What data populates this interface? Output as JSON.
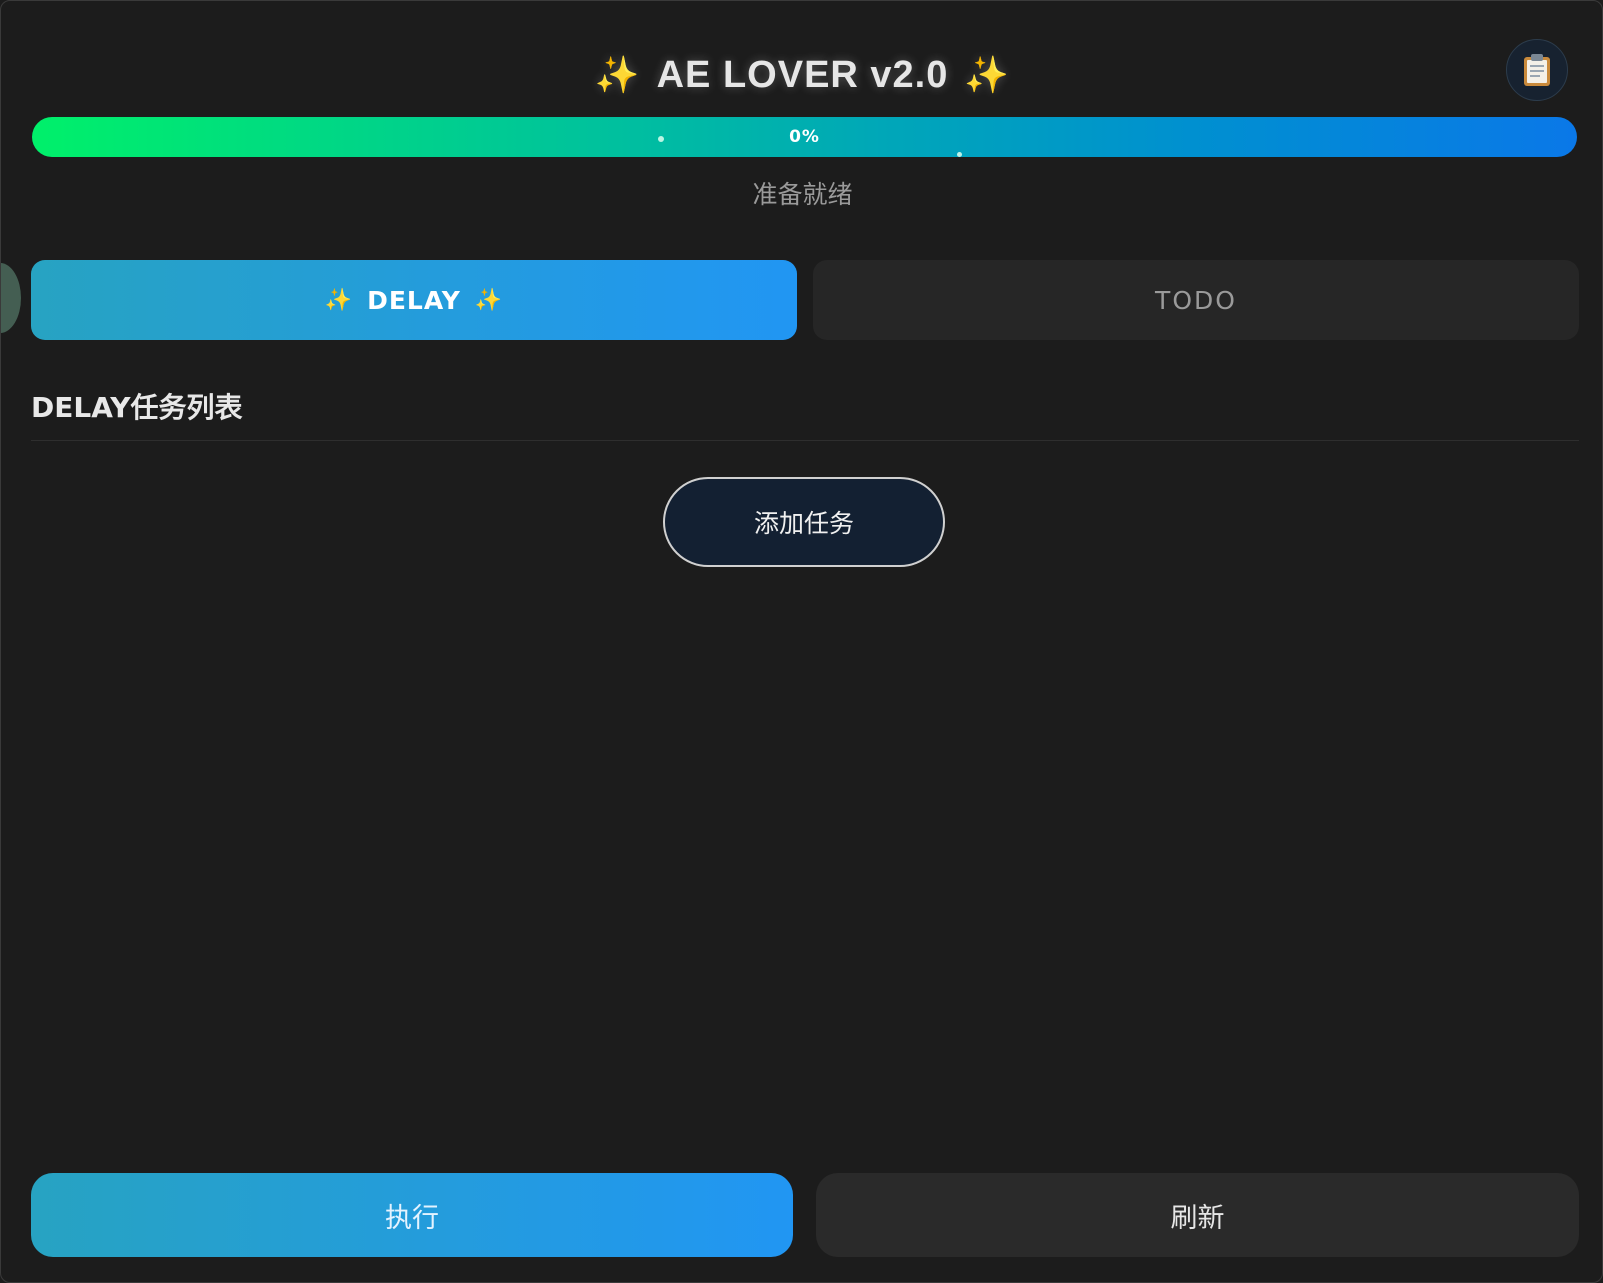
{
  "header": {
    "title_text": "AE LOVER v2.0",
    "sparkle_glyph": "✨",
    "clipboard_icon": "clipboard-icon"
  },
  "progress": {
    "value_percent": 0,
    "label": "0%"
  },
  "status": {
    "text": "准备就绪"
  },
  "tabs": [
    {
      "label": "DELAY",
      "active": true
    },
    {
      "label": "TODO",
      "active": false
    }
  ],
  "section": {
    "title": "DELAY任务列表"
  },
  "add_task_button": {
    "label": "添加任务"
  },
  "footer": {
    "run_label": "执行",
    "refresh_label": "刷新"
  },
  "colors": {
    "background": "#1c1c1c",
    "accent_start": "#27a3c2",
    "accent_end": "#2196f3",
    "sparkle": "#ffc83d"
  }
}
